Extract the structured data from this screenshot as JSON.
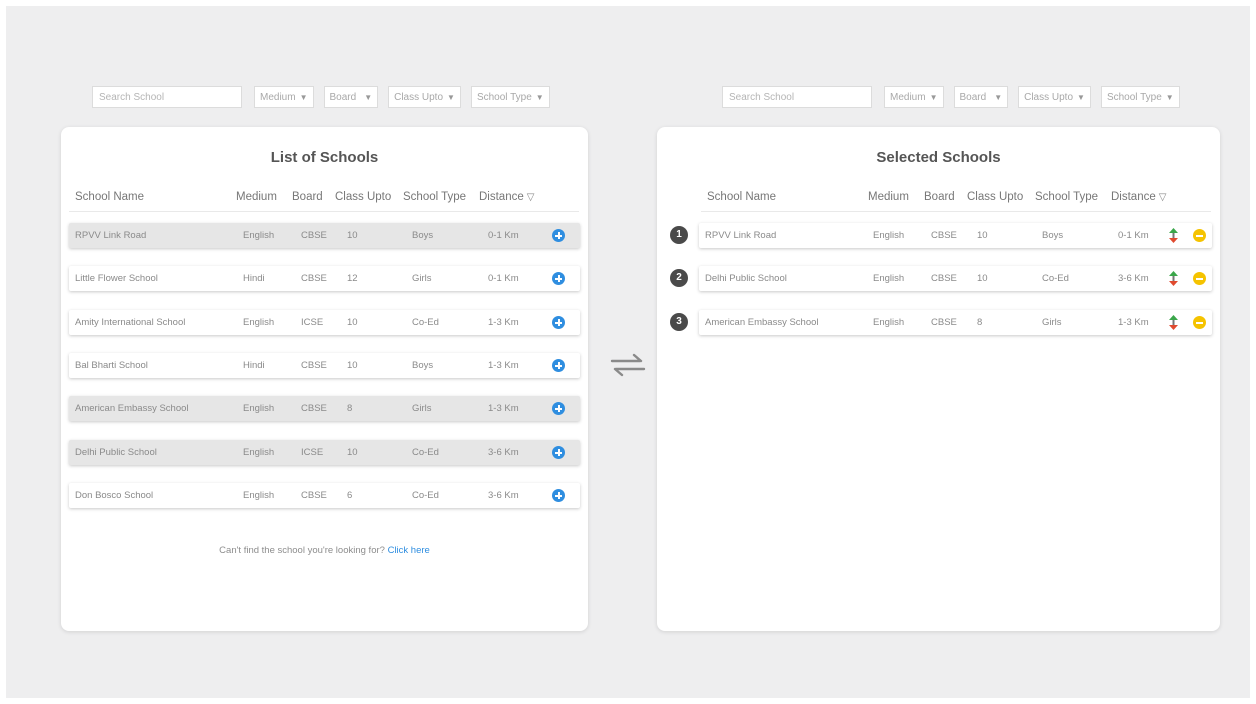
{
  "filters": {
    "search_placeholder": "Search School",
    "dropdowns": [
      "Medium",
      "Board",
      "Class Upto",
      "School Type"
    ]
  },
  "left_panel": {
    "title": "List of Schools",
    "columns": [
      "School Name",
      "Medium",
      "Board",
      "Class Upto",
      "School Type",
      "Distance"
    ],
    "rows": [
      {
        "name": "RPVV Link Road",
        "medium": "English",
        "board": "CBSE",
        "class": "10",
        "type": "Boys",
        "distance": "0-1 Km",
        "highlighted": true
      },
      {
        "name": "Little Flower School",
        "medium": "Hindi",
        "board": "CBSE",
        "class": "12",
        "type": "Girls",
        "distance": "0-1 Km",
        "highlighted": false
      },
      {
        "name": "Amity International School",
        "medium": "English",
        "board": "ICSE",
        "class": "10",
        "type": "Co-Ed",
        "distance": "1-3 Km",
        "highlighted": false
      },
      {
        "name": "Bal Bharti School",
        "medium": "Hindi",
        "board": "CBSE",
        "class": "10",
        "type": "Boys",
        "distance": "1-3 Km",
        "highlighted": false
      },
      {
        "name": "American Embassy School",
        "medium": "English",
        "board": "CBSE",
        "class": "8",
        "type": "Girls",
        "distance": "1-3 Km",
        "highlighted": true
      },
      {
        "name": "Delhi Public School",
        "medium": "English",
        "board": "ICSE",
        "class": "10",
        "type": "Co-Ed",
        "distance": "3-6 Km",
        "highlighted": true
      },
      {
        "name": "Don Bosco School",
        "medium": "English",
        "board": "CBSE",
        "class": "6",
        "type": "Co-Ed",
        "distance": "3-6 Km",
        "highlighted": false
      }
    ],
    "footnote_text": "Can't find the school you're looking for?",
    "footnote_link": "Click here"
  },
  "right_panel": {
    "title": "Selected Schools",
    "columns": [
      "School Name",
      "Medium",
      "Board",
      "Class Upto",
      "School Type",
      "Distance"
    ],
    "rows": [
      {
        "rank": "1",
        "name": "RPVV Link Road",
        "medium": "English",
        "board": "CBSE",
        "class": "10",
        "type": "Boys",
        "distance": "0-1 Km"
      },
      {
        "rank": "2",
        "name": "Delhi Public School",
        "medium": "English",
        "board": "CBSE",
        "class": "10",
        "type": "Co-Ed",
        "distance": "3-6 Km"
      },
      {
        "rank": "3",
        "name": "American Embassy School",
        "medium": "English",
        "board": "CBSE",
        "class": "8",
        "type": "Girls",
        "distance": "1-3 Km"
      }
    ]
  },
  "icons": {
    "add": "plus-circle-icon",
    "remove": "minus-circle-icon",
    "reorder": "up-down-arrow-icon",
    "swap": "swap-arrows-icon",
    "dropdown": "caret-down-icon",
    "sort": "sort-down-icon"
  },
  "colors": {
    "accent_blue": "#2f8ee0",
    "remove_yellow": "#f5c300",
    "up_green": "#3aa64a",
    "down_red": "#e04a2f",
    "badge_dark": "#4a4a4a",
    "row_highlight": "#e6e6e6"
  }
}
